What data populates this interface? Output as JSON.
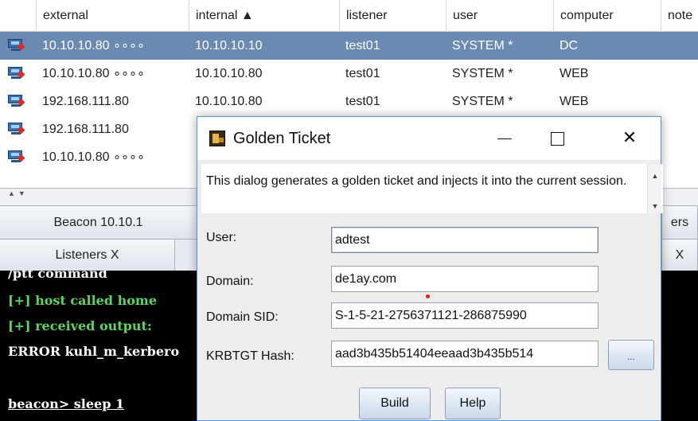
{
  "table": {
    "columns": [
      "external",
      "internal ▲",
      "listener",
      "user",
      "computer",
      "note"
    ],
    "rows": [
      {
        "external": "10.10.10.80 ∘∘∘∘",
        "internal": "10.10.10.10",
        "listener": "test01",
        "user": "SYSTEM *",
        "computer": "DC",
        "selected": true
      },
      {
        "external": "10.10.10.80 ∘∘∘∘",
        "internal": "10.10.10.80",
        "listener": "test01",
        "user": "SYSTEM *",
        "computer": "WEB"
      },
      {
        "external": "192.168.111.80",
        "internal": "10.10.10.80",
        "listener": "test01",
        "user": "SYSTEM *",
        "computer": "WEB"
      },
      {
        "external": "192.168.111.80",
        "internal": "",
        "listener": "",
        "user": "",
        "computer": ""
      },
      {
        "external": "10.10.10.80 ∘∘∘∘",
        "internal": "",
        "listener": "",
        "user": "",
        "computer": ""
      }
    ],
    "row_icon": "beacon-computer-icon",
    "selected_row_color": "#6b8ab1"
  },
  "tabs_top": {
    "beacon_tab": "Beacon 10.10.1",
    "right_tab": "ers"
  },
  "tabs_bottom": {
    "listeners_tab": "Listeners  X",
    "right_tab": "X"
  },
  "console": {
    "lines": [
      "/ptt command",
      "[+] host called home",
      "[+] received output:",
      "ERROR kuhl_m_kerbero",
      "",
      "beacon> sleep 1"
    ]
  },
  "dialog": {
    "title": "Golden Ticket",
    "title_icon": "golden-ticket-icon",
    "description": "This dialog generates a golden ticket and injects it into the current session.",
    "fields": {
      "user_label": "User:",
      "user_value": "adtest",
      "domain_label": "Domain:",
      "domain_value": "de1ay.com",
      "sid_label": "Domain SID:",
      "sid_value": "S-1-5-21-2756371121-286875990",
      "hash_label": "KRBTGT Hash:",
      "hash_value": "aad3b435b51404eeaad3b435b514"
    },
    "browse_label": "...",
    "build_label": "Build",
    "help_label": "Help",
    "min_icon": "minimize-icon",
    "max_icon": "maximize-icon",
    "close_icon": "close-icon"
  },
  "colors": {
    "dialog_border": "#5a92d6",
    "console_bg": "#000000",
    "console_green": "#5fd35f"
  }
}
